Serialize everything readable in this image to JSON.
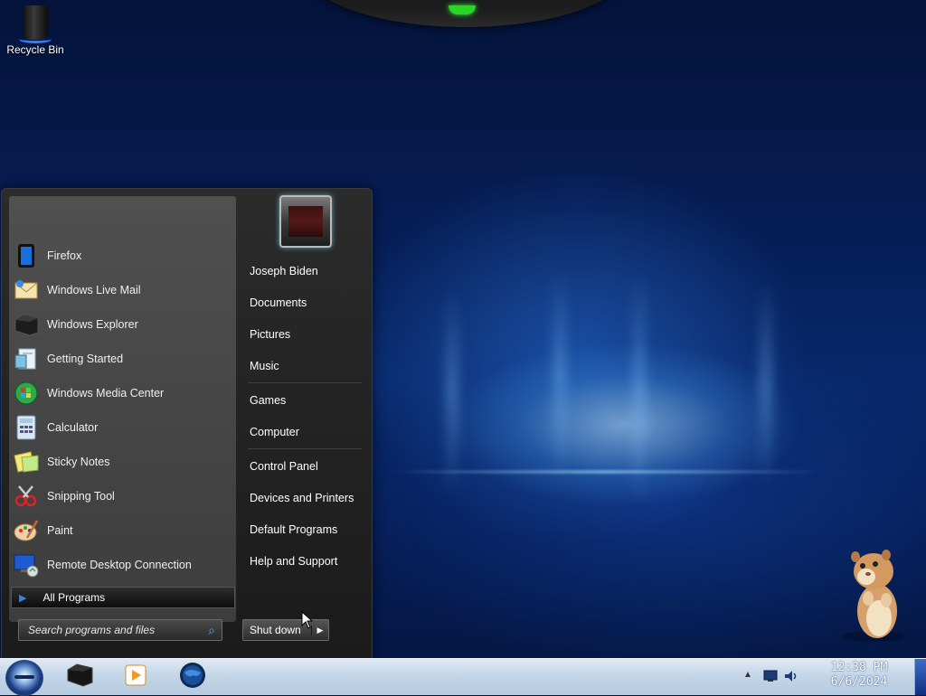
{
  "desktop": {
    "icons": [
      {
        "label": "Recycle Bin",
        "icon": "recycle-bin-icon"
      }
    ]
  },
  "start_menu": {
    "programs": [
      {
        "label": "Firefox",
        "icon": "firefox-icon"
      },
      {
        "label": "Windows Live Mail",
        "icon": "mail-icon"
      },
      {
        "label": "Windows Explorer",
        "icon": "folder-icon"
      },
      {
        "label": "Getting Started",
        "icon": "getting-started-icon"
      },
      {
        "label": "Windows Media Center",
        "icon": "media-center-icon"
      },
      {
        "label": "Calculator",
        "icon": "calculator-icon"
      },
      {
        "label": "Sticky Notes",
        "icon": "sticky-notes-icon"
      },
      {
        "label": "Snipping Tool",
        "icon": "scissors-icon"
      },
      {
        "label": "Paint",
        "icon": "paint-icon"
      },
      {
        "label": "Remote Desktop Connection",
        "icon": "remote-desktop-icon"
      }
    ],
    "all_programs_label": "All Programs",
    "search_placeholder": "Search programs and files",
    "user_name": "Joseph Biden",
    "right_items": [
      "Documents",
      "Pictures",
      "Music",
      "Games",
      "Computer",
      "Control Panel",
      "Devices and Printers",
      "Default Programs",
      "Help and Support"
    ],
    "shutdown_label": "Shut down"
  },
  "taskbar": {
    "pinned": [
      {
        "icon": "explorer-icon"
      },
      {
        "icon": "media-player-icon"
      },
      {
        "icon": "globe-icon"
      }
    ],
    "time": "12:38 PM",
    "date": "6/6/2024"
  },
  "colors": {
    "accent": "#2f7fff",
    "menu_bg": "#1b1b1b",
    "taskbar": "#c4d6e8"
  }
}
